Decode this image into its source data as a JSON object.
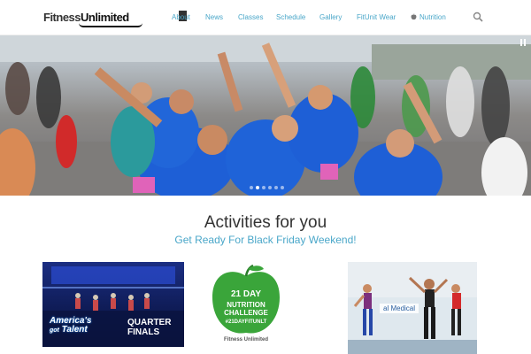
{
  "brand": {
    "name": "Fitness",
    "name_accent": "Unlimited"
  },
  "nav": {
    "items": [
      {
        "label": "About",
        "key": "about"
      },
      {
        "label": "News",
        "key": "news"
      },
      {
        "label": "Classes",
        "key": "classes"
      },
      {
        "label": "Schedule",
        "key": "schedule"
      },
      {
        "label": "Gallery",
        "key": "gallery"
      },
      {
        "label": "FitUnit Wear",
        "key": "fitunit-wear"
      },
      {
        "label": "Nutrition",
        "key": "nutrition"
      }
    ],
    "search_icon": "search-icon"
  },
  "hero": {
    "slide_count": 6,
    "active_slide": 1
  },
  "activities": {
    "title": "Activities for you",
    "subtitle": "Get Ready For Black Friday Weekend!",
    "cards": [
      {
        "agt_line1": "America's",
        "agt_line2": "got",
        "agt_line3": "Talent",
        "caption_line1": "QUARTER",
        "caption_line2": "FINALS"
      },
      {
        "line1": "21 DAY",
        "line2": "NUTRITION",
        "line3": "CHALLENGE",
        "line4": "#21DAYFITUNLT",
        "brand": "Fitness Unlimited"
      },
      {
        "banner": "al Medical"
      }
    ]
  },
  "colors": {
    "accent": "#4aa7c9",
    "apple_green": "#3aa53a",
    "shirt_blue": "#1e5fd6"
  }
}
